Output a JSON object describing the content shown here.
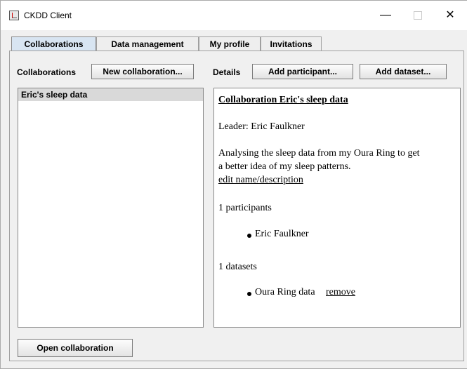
{
  "window": {
    "title": "CKDD Client",
    "minimize": "—",
    "close": "✕"
  },
  "tabs": [
    {
      "label": "Collaborations",
      "active": true
    },
    {
      "label": "Data management",
      "active": false
    },
    {
      "label": "My profile",
      "active": false
    },
    {
      "label": "Invitations",
      "active": false
    }
  ],
  "left_panel": {
    "label": "Collaborations",
    "new_button": "New collaboration...",
    "items": [
      "Eric's sleep data"
    ],
    "open_button": "Open collaboration"
  },
  "details_panel": {
    "label": "Details",
    "add_participant_button": "Add participant...",
    "add_dataset_button": "Add dataset...",
    "title": "Collaboration Eric's sleep data",
    "leader": "Leader: Eric Faulkner",
    "description_line1": "Analysing the sleep data from my Oura Ring to get",
    "description_line2": "a better idea of my sleep patterns.",
    "edit_link": "edit name/description",
    "participants_count": "1 participants",
    "participants": [
      "Eric Faulkner"
    ],
    "datasets_count": "1 datasets",
    "datasets": [
      {
        "name": "Oura Ring data",
        "action": "remove"
      }
    ]
  }
}
